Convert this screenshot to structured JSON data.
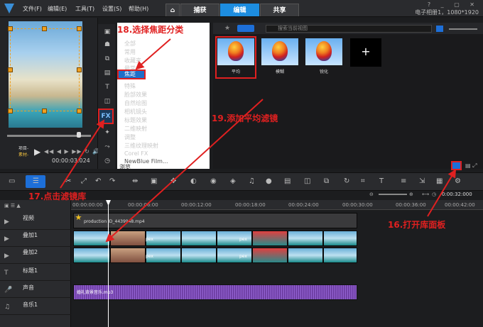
{
  "menu": [
    "文件(F)",
    "编辑(E)",
    "工具(T)",
    "设置(S)",
    "帮助(H)"
  ],
  "tabs": [
    "捕获",
    "编辑",
    "共享"
  ],
  "project_info": "电子相册1，1080*1920",
  "player": {
    "mode_project": "项目-",
    "mode_clip": "素材-",
    "timecode": "00:00:03.024"
  },
  "categories": [
    "全部",
    "常用",
    "收藏夹",
    "最常",
    "焦距",
    "特殊",
    "脸部效果",
    "自然绘图",
    "相机镜头",
    "标题效果",
    "二维映射",
    "调整",
    "三维纹理映射",
    "Corel FX",
    "NewBlue Film..."
  ],
  "browse": "浏览",
  "search_placeholder": "搜索当前视图",
  "thumbnails": [
    "平均",
    "模糊",
    "锐化"
  ],
  "add_label": "+",
  "ruler": [
    "00:00:00:00",
    "00:00:06:00",
    "00:00:12:00",
    "00:00:18:00",
    "00:00:24:00",
    "00:00:30:00",
    "00:00:36:00",
    "00:00:42:00"
  ],
  "timeline_time": "0:00:32:000",
  "tracks": [
    "视频",
    "叠加1",
    "叠加2",
    "标题1",
    "声音",
    "音乐1"
  ],
  "video_clip": "production ID_4439948.mp4",
  "audio_clip": "婚礼背景音乐.mp3",
  "clip_text": "pex",
  "annotations": {
    "a16": "16.打开库面板",
    "a17": "17.点击滤镜库",
    "a18": "18.选择焦距分类",
    "a19": "19.添加平均滤镜"
  },
  "accent": "#1d8de0",
  "annotation_color": "#e02020"
}
